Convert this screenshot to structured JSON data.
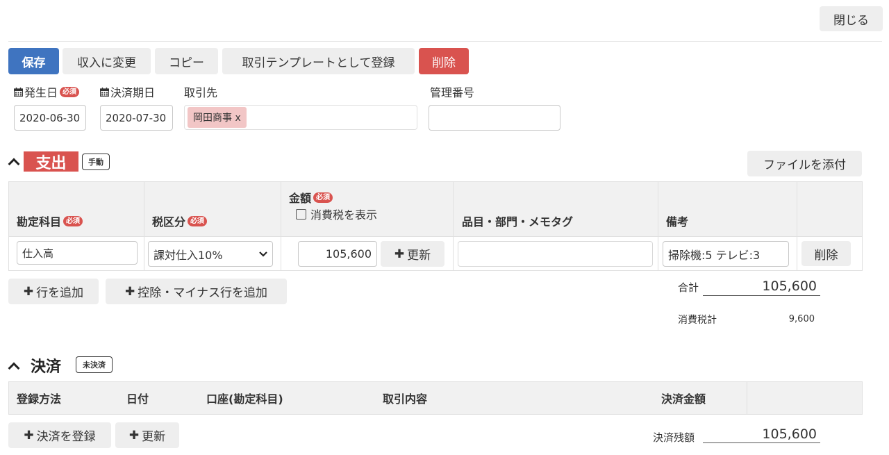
{
  "header": {
    "close_label": "閉じる"
  },
  "toolbar": {
    "save_label": "保存",
    "to_income_label": "収入に変更",
    "copy_label": "コピー",
    "register_template_label": "取引テンプレートとして登録",
    "delete_label": "削除"
  },
  "form": {
    "required_tag": "必須",
    "date_label": "発生日",
    "date_value": "2020-06-30",
    "due_label": "決済期日",
    "due_value": "2020-07-30",
    "partner_label": "取引先",
    "partner_tag": "岡田商事 x",
    "mgmt_label": "管理番号",
    "mgmt_value": ""
  },
  "expense": {
    "title": "支出",
    "mode_badge": "手動",
    "attach_label": "ファイルを添付",
    "columns": {
      "account": "勘定科目",
      "tax": "税区分",
      "amount": "金額",
      "show_tax_label": "消費税を表示",
      "item": "品目・部門・メモタグ",
      "note": "備考"
    },
    "row": {
      "account": "仕入高",
      "tax": "課対仕入10%",
      "amount": "105,600",
      "update_label": "更新",
      "item": "",
      "note": "掃除機:5 テレビ:3",
      "delete_label": "削除"
    },
    "add_row_label": "行を追加",
    "add_minus_row_label": "控除・マイナス行を追加",
    "total_label": "合計",
    "total_value": "105,600",
    "tax_total_label": "消費税計",
    "tax_total_value": "9,600"
  },
  "settlement": {
    "title": "決済",
    "status_badge": "未決済",
    "columns": {
      "method": "登録方法",
      "date": "日付",
      "account": "口座(勘定科目)",
      "content": "取引内容",
      "amount": "決済金額"
    },
    "register_label": "決済を登録",
    "update_label": "更新",
    "balance_label": "決済残額",
    "balance_value": "105,600"
  }
}
